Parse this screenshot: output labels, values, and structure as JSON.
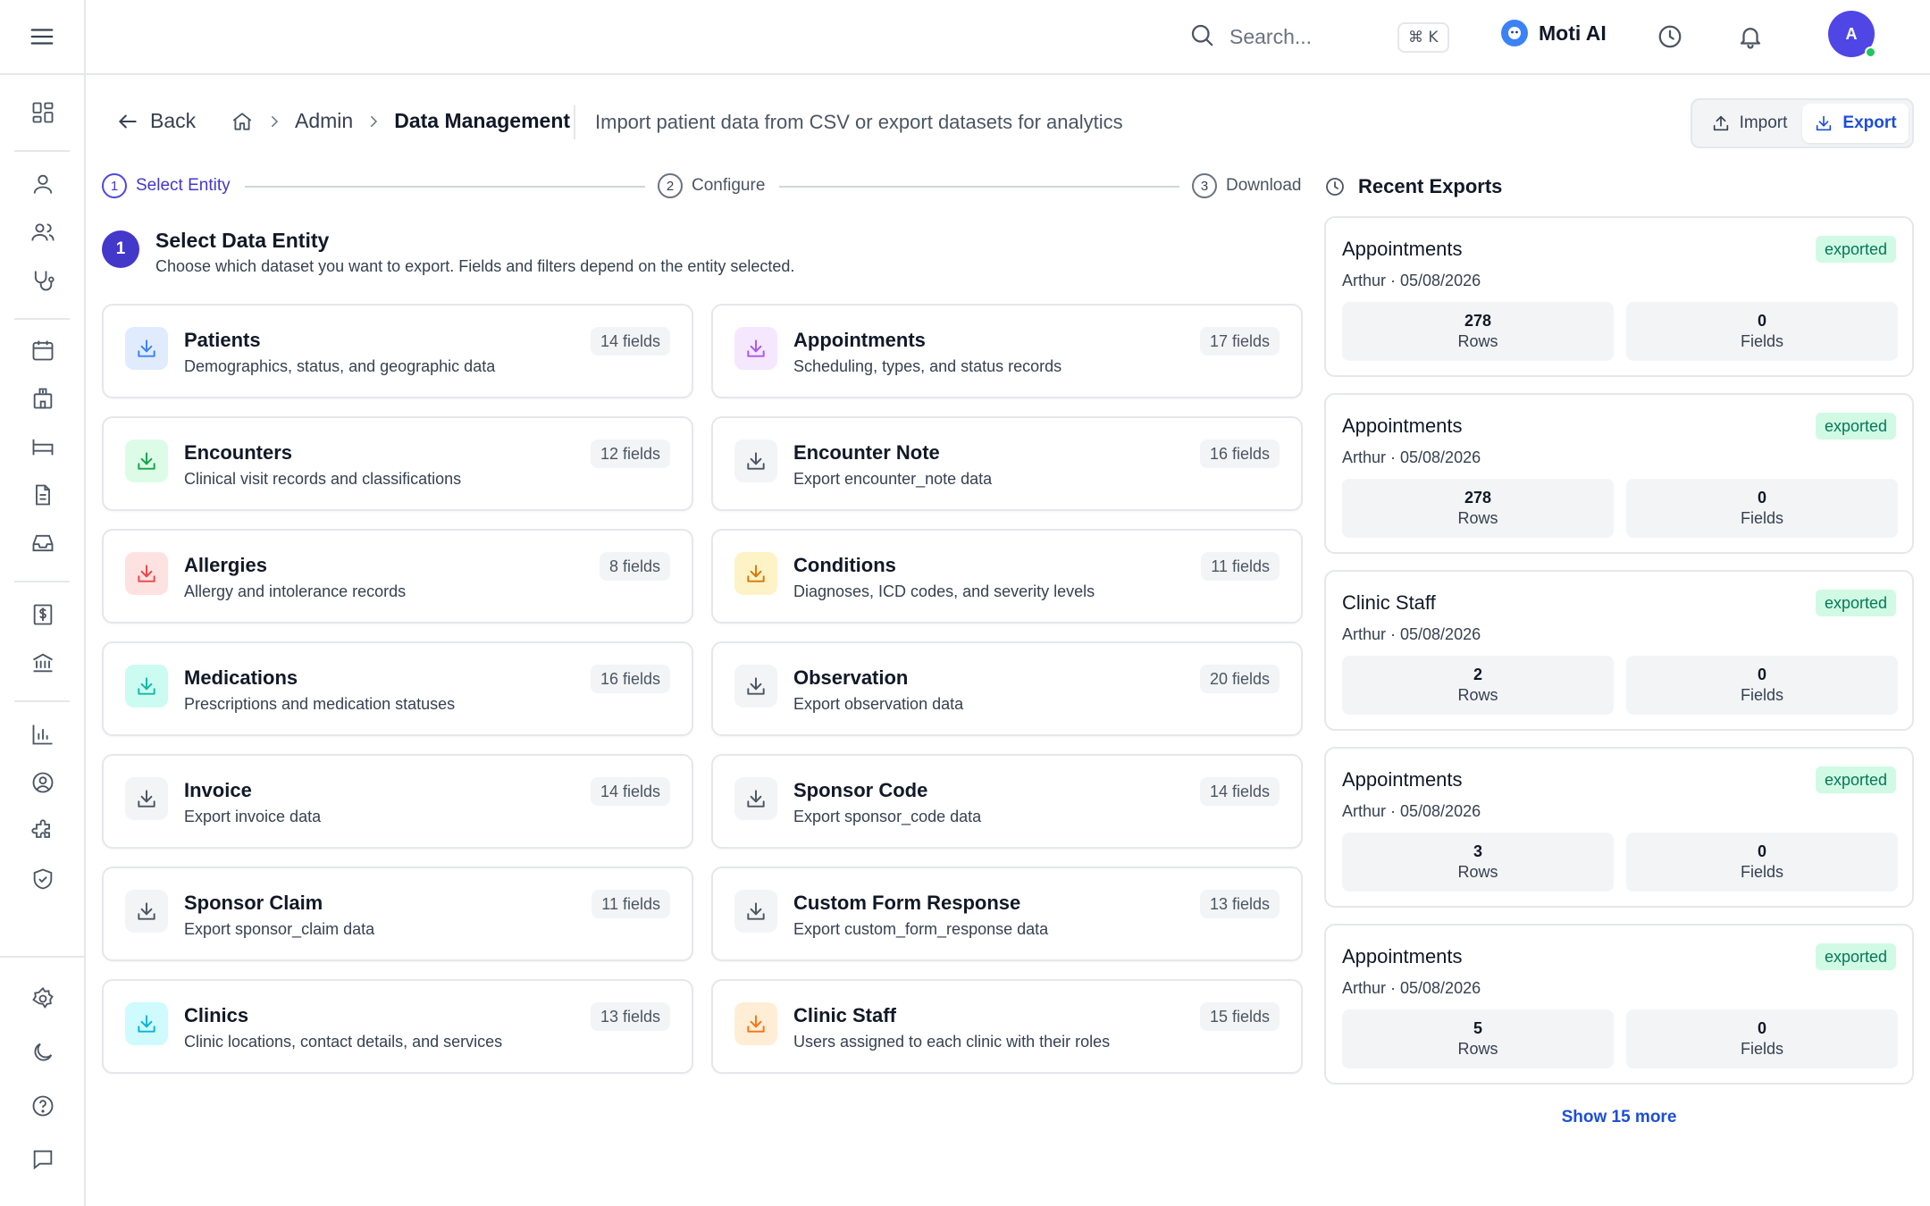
{
  "topbar": {
    "search_placeholder": "Search...",
    "shortcut": "⌘ K",
    "assistant_label": "Moti AI",
    "avatar_initial": "A"
  },
  "header": {
    "back_label": "Back",
    "breadcrumb": [
      "Admin",
      "Data Management"
    ],
    "subtitle": "Import patient data from CSV or export datasets for analytics",
    "import_label": "Import",
    "export_label": "Export"
  },
  "stepper": [
    {
      "num": "1",
      "label": "Select Entity",
      "active": true
    },
    {
      "num": "2",
      "label": "Configure",
      "active": false
    },
    {
      "num": "3",
      "label": "Download",
      "active": false
    }
  ],
  "section": {
    "number": "1",
    "title": "Select Data Entity",
    "subtitle": "Choose which dataset you want to export. Fields and filters depend on the entity selected."
  },
  "entities": [
    {
      "title": "Patients",
      "desc": "Demographics, status, and geographic data",
      "fields": "14 fields",
      "icon_bg": "#e0ecfe",
      "icon_color": "#3b82f6"
    },
    {
      "title": "Appointments",
      "desc": "Scheduling, types, and status records",
      "fields": "17 fields",
      "icon_bg": "#f5e8fe",
      "icon_color": "#a855f7"
    },
    {
      "title": "Encounters",
      "desc": "Clinical visit records and classifications",
      "fields": "12 fields",
      "icon_bg": "#dcfce7",
      "icon_color": "#16a34a"
    },
    {
      "title": "Encounter Note",
      "desc": "Export encounter_note data",
      "fields": "16 fields",
      "icon_bg": "#f3f4f6",
      "icon_color": "#4b5563"
    },
    {
      "title": "Allergies",
      "desc": "Allergy and intolerance records",
      "fields": "8 fields",
      "icon_bg": "#fee2e2",
      "icon_color": "#ef4444"
    },
    {
      "title": "Conditions",
      "desc": "Diagnoses, ICD codes, and severity levels",
      "fields": "11 fields",
      "icon_bg": "#fef3c7",
      "icon_color": "#d97706"
    },
    {
      "title": "Medications",
      "desc": "Prescriptions and medication statuses",
      "fields": "16 fields",
      "icon_bg": "#ccfbf1",
      "icon_color": "#14b8a6"
    },
    {
      "title": "Observation",
      "desc": "Export observation data",
      "fields": "20 fields",
      "icon_bg": "#f3f4f6",
      "icon_color": "#4b5563"
    },
    {
      "title": "Invoice",
      "desc": "Export invoice data",
      "fields": "14 fields",
      "icon_bg": "#f3f4f6",
      "icon_color": "#4b5563"
    },
    {
      "title": "Sponsor Code",
      "desc": "Export sponsor_code data",
      "fields": "14 fields",
      "icon_bg": "#f3f4f6",
      "icon_color": "#4b5563"
    },
    {
      "title": "Sponsor Claim",
      "desc": "Export sponsor_claim data",
      "fields": "11 fields",
      "icon_bg": "#f3f4f6",
      "icon_color": "#4b5563"
    },
    {
      "title": "Custom Form Response",
      "desc": "Export custom_form_response data",
      "fields": "13 fields",
      "icon_bg": "#f3f4f6",
      "icon_color": "#4b5563"
    },
    {
      "title": "Clinics",
      "desc": "Clinic locations, contact details, and services",
      "fields": "13 fields",
      "icon_bg": "#cffafe",
      "icon_color": "#06b6d4"
    },
    {
      "title": "Clinic Staff",
      "desc": "Users assigned to each clinic with their roles",
      "fields": "15 fields",
      "icon_bg": "#ffedd5",
      "icon_color": "#f97316"
    }
  ],
  "recent": {
    "title": "Recent Exports",
    "items": [
      {
        "title": "Appointments",
        "meta": "Arthur · 05/08/2026",
        "status": "exported",
        "rows": "278",
        "rows_label": "Rows",
        "fields": "0",
        "fields_label": "Fields"
      },
      {
        "title": "Appointments",
        "meta": "Arthur · 05/08/2026",
        "status": "exported",
        "rows": "278",
        "rows_label": "Rows",
        "fields": "0",
        "fields_label": "Fields"
      },
      {
        "title": "Clinic Staff",
        "meta": "Arthur · 05/08/2026",
        "status": "exported",
        "rows": "2",
        "rows_label": "Rows",
        "fields": "0",
        "fields_label": "Fields"
      },
      {
        "title": "Appointments",
        "meta": "Arthur · 05/08/2026",
        "status": "exported",
        "rows": "3",
        "rows_label": "Rows",
        "fields": "0",
        "fields_label": "Fields"
      },
      {
        "title": "Appointments",
        "meta": "Arthur · 05/08/2026",
        "status": "exported",
        "rows": "5",
        "rows_label": "Rows",
        "fields": "0",
        "fields_label": "Fields"
      }
    ],
    "show_more": "Show 15 more"
  },
  "sidebar_icons": [
    "menu-icon",
    "dashboard-icon",
    "user-icon",
    "users-icon",
    "stethoscope-icon",
    "calendar-icon",
    "hospital-icon",
    "bed-icon",
    "document-icon",
    "inbox-icon",
    "billing-icon",
    "bank-icon",
    "chart-icon",
    "profile-icon",
    "puzzle-icon",
    "shield-icon",
    "settings-icon",
    "moon-icon",
    "help-icon",
    "chat-icon"
  ]
}
